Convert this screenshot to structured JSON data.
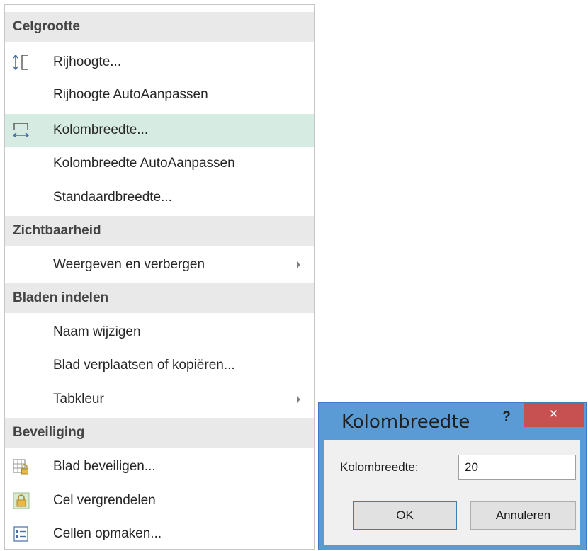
{
  "menu": {
    "sections": {
      "cell_size": "Celgrootte",
      "visibility": "Zichtbaarheid",
      "organize_sheets": "Bladen indelen",
      "protection": "Beveiliging"
    },
    "items": {
      "row_height": "Rijhoogte...",
      "autofit_row_height": "Rijhoogte AutoAanpassen",
      "column_width": "Kolombreedte...",
      "autofit_column_width": "Kolombreedte AutoAanpassen",
      "default_width": "Standaardbreedte...",
      "hide_unhide": "Weergeven en verbergen",
      "rename_sheet": "Naam wijzigen",
      "move_copy_sheet": "Blad verplaatsen of kopiëren...",
      "tab_color": "Tabkleur",
      "protect_sheet": "Blad beveiligen...",
      "lock_cell": "Cel vergrendelen",
      "format_cells": "Cellen opmaken..."
    },
    "highlighted_item": "column_width",
    "highlight_color": "#d6ece2",
    "header_color": "#e9e9e9"
  },
  "dialog": {
    "title": "Kolombreedte",
    "help_label": "?",
    "close_label": "×",
    "field_label": "Kolombreedte:",
    "field_value": "20",
    "ok_label": "OK",
    "cancel_label": "Annuleren",
    "frame_color": "#5b9bd5",
    "close_color": "#c75050"
  },
  "icons": {
    "row_height": "row-height-icon",
    "column_width": "column-width-icon",
    "protect_sheet": "protect-sheet-icon",
    "lock_cell": "lock-icon",
    "format_cells": "format-cells-icon"
  }
}
